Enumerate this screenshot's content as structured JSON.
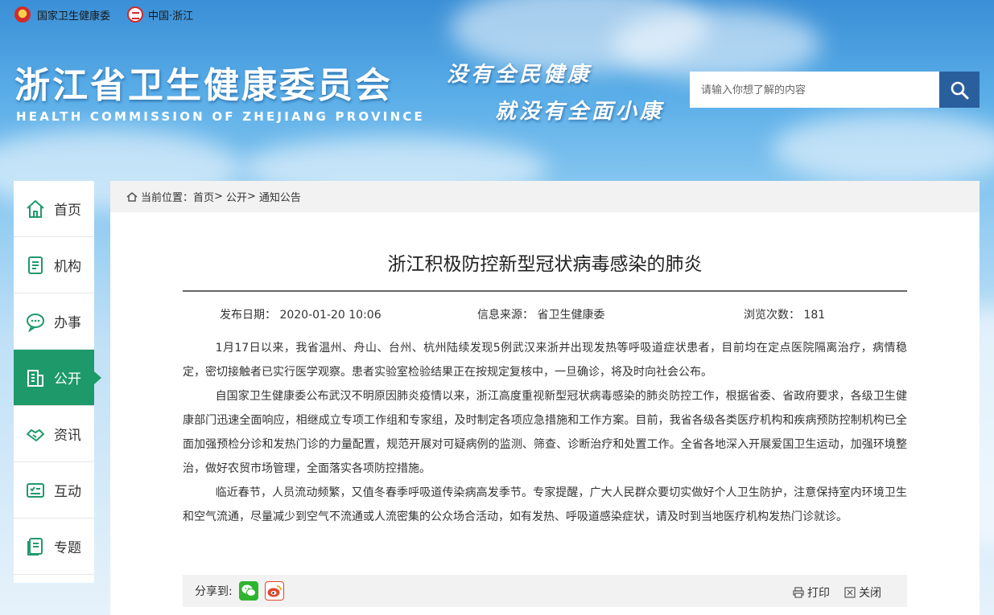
{
  "topbar": {
    "nhc_label": "国家卫生健康委",
    "china_zj_label": "中国·浙江"
  },
  "header": {
    "site_title": "浙江省卫生健康委员会",
    "site_subtitle": "HEALTH COMMISSION OF ZHEJIANG PROVINCE",
    "slogan_line1": "没有全民健康",
    "slogan_line2": "就没有全面小康"
  },
  "search": {
    "placeholder": "请输入你想了解的内容"
  },
  "sidebar": {
    "items": [
      {
        "label": "首页",
        "icon": "home-icon"
      },
      {
        "label": "机构",
        "icon": "document-icon"
      },
      {
        "label": "办事",
        "icon": "chat-icon"
      },
      {
        "label": "公开",
        "icon": "building-icon",
        "active": true
      },
      {
        "label": "资讯",
        "icon": "handshake-icon"
      },
      {
        "label": "互动",
        "icon": "board-icon"
      },
      {
        "label": "专题",
        "icon": "book-icon"
      }
    ]
  },
  "breadcrumb": {
    "prefix": "当前位置：",
    "items": [
      "首页",
      "公开",
      "通知公告"
    ],
    "sep": ">"
  },
  "article": {
    "title": "浙江积极防控新型冠状病毒感染的肺炎",
    "publish_label": "发布日期：",
    "publish_date": "2020-01-20 10:06",
    "source_label": "信息来源：",
    "source": "省卫生健康委",
    "views_label": "浏览次数：",
    "views": "181",
    "paragraphs": [
      "1月17日以来，我省温州、舟山、台州、杭州陆续发现5例武汉来浙并出现发热等呼吸道症状患者，目前均在定点医院隔离治疗，病情稳定，密切接触者已实行医学观察。患者实验室检验结果正在按规定复核中，一旦确诊，将及时向社会公布。",
      "自国家卫生健康委公布武汉不明原因肺炎疫情以来，浙江高度重视新型冠状病毒感染的肺炎防控工作，根据省委、省政府要求，各级卫生健康部门迅速全面响应，相继成立专项工作组和专家组，及时制定各项应急措施和工作方案。目前，我省各级各类医疗机构和疾病预防控制机构已全面加强预检分诊和发热门诊的力量配置，规范开展对可疑病例的监测、筛查、诊断治疗和处置工作。全省各地深入开展爱国卫生运动，加强环境整治，做好农贸市场管理，全面落实各项防控措施。",
      "临近春节，人员流动频繁，又值冬春季呼吸道传染病高发季节。专家提醒，广大人民群众要切实做好个人卫生防护，注意保持室内环境卫生和空气流通，尽量减少到空气不流通或人流密集的公众场合活动，如有发热、呼吸道感染症状，请及时到当地医疗机构发热门诊就诊。"
    ]
  },
  "share": {
    "label": "分享到:",
    "print_label": "打印",
    "close_label": "关闭"
  },
  "colors": {
    "accent_green": "#1e9a6a",
    "search_button": "#2a5f9e"
  }
}
